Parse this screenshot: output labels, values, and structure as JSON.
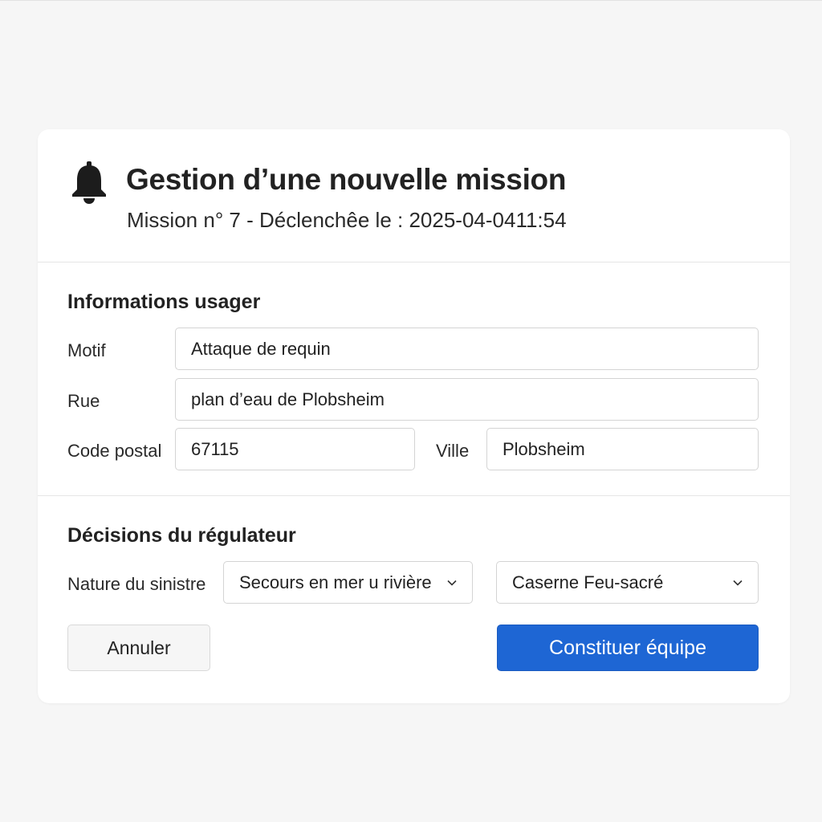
{
  "dialog": {
    "title": "Gestion d’une nouvelle mission",
    "subtitle": "Mission n° 7 - Déclenchêe le : 2025-04-0411:54",
    "icon": "bell-icon"
  },
  "usager": {
    "section_title": "Informations usager",
    "motif": {
      "label": "Motif",
      "value": "Attaque de requin"
    },
    "rue": {
      "label": "Rue",
      "value": "plan d’eau de Plobsheim"
    },
    "code_postal": {
      "label": "Code postal",
      "value": "67115"
    },
    "ville": {
      "label": "Ville",
      "value": "Plobsheim"
    }
  },
  "decisions": {
    "section_title": "Décisions du régulateur",
    "nature_label": "Nature du sinistre",
    "nature_value": "Secours en mer u rivière",
    "caserne_value": "Caserne Feu-sacré"
  },
  "actions": {
    "cancel_label": "Annuler",
    "submit_label": "Constituer équipe"
  },
  "colors": {
    "primary": "#1e66d4",
    "background": "#f6f6f6",
    "card": "#ffffff"
  }
}
